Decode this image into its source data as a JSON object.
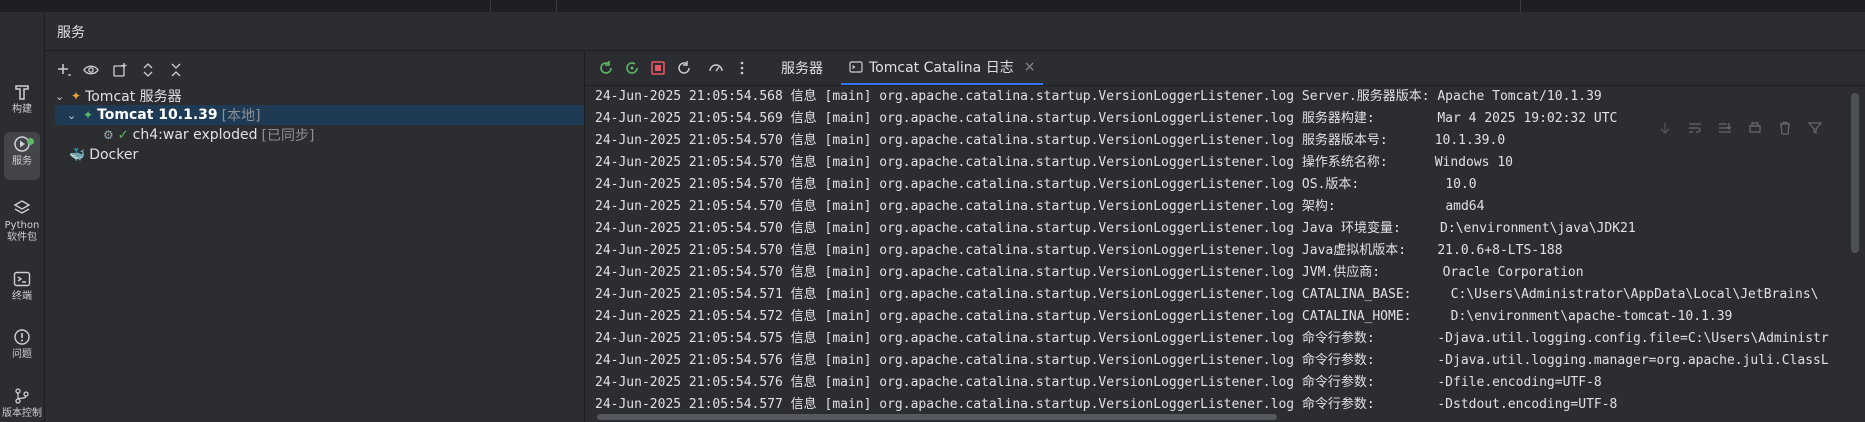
{
  "left_toolbar": [
    {
      "label": "构建",
      "icon": "hammer-icon"
    },
    {
      "label": "服务",
      "icon": "services-icon"
    },
    {
      "label": "Python\n软件包",
      "icon": "layers-icon"
    },
    {
      "label": "终端",
      "icon": "terminal-icon"
    },
    {
      "label": "问题",
      "icon": "problems-icon"
    },
    {
      "label": "版本控制",
      "icon": "git-branch-icon"
    }
  ],
  "panel": {
    "title": "服务"
  },
  "tree": {
    "root": {
      "label": "Tomcat 服务器"
    },
    "server": {
      "name": "Tomcat 10.1.39",
      "tag": "[本地]"
    },
    "artifact": {
      "name": "ch4:war exploded",
      "tag": "[已同步]"
    },
    "docker": {
      "label": "Docker"
    }
  },
  "log_tabs": [
    {
      "label": "服务器"
    },
    {
      "label": "Tomcat Catalina 日志",
      "close": "×"
    }
  ],
  "log_lines": [
    "24-Jun-2025 21:05:54.568 信息 [main] org.apache.catalina.startup.VersionLoggerListener.log Server.服务器版本: Apache Tomcat/10.1.39",
    "24-Jun-2025 21:05:54.569 信息 [main] org.apache.catalina.startup.VersionLoggerListener.log 服务器构建:        Mar 4 2025 19:02:32 UTC",
    "24-Jun-2025 21:05:54.570 信息 [main] org.apache.catalina.startup.VersionLoggerListener.log 服务器版本号:      10.1.39.0",
    "24-Jun-2025 21:05:54.570 信息 [main] org.apache.catalina.startup.VersionLoggerListener.log 操作系统名称:      Windows 10",
    "24-Jun-2025 21:05:54.570 信息 [main] org.apache.catalina.startup.VersionLoggerListener.log OS.版本:           10.0",
    "24-Jun-2025 21:05:54.570 信息 [main] org.apache.catalina.startup.VersionLoggerListener.log 架构:              amd64",
    "24-Jun-2025 21:05:54.570 信息 [main] org.apache.catalina.startup.VersionLoggerListener.log Java 环境变量:     D:\\environment\\java\\JDK21",
    "24-Jun-2025 21:05:54.570 信息 [main] org.apache.catalina.startup.VersionLoggerListener.log Java虚拟机版本:    21.0.6+8-LTS-188",
    "24-Jun-2025 21:05:54.570 信息 [main] org.apache.catalina.startup.VersionLoggerListener.log JVM.供应商:        Oracle Corporation",
    "24-Jun-2025 21:05:54.571 信息 [main] org.apache.catalina.startup.VersionLoggerListener.log CATALINA_BASE:     C:\\Users\\Administrator\\AppData\\Local\\JetBrains\\",
    "24-Jun-2025 21:05:54.572 信息 [main] org.apache.catalina.startup.VersionLoggerListener.log CATALINA_HOME:     D:\\environment\\apache-tomcat-10.1.39",
    "24-Jun-2025 21:05:54.575 信息 [main] org.apache.catalina.startup.VersionLoggerListener.log 命令行参数:        -Djava.util.logging.config.file=C:\\Users\\Administr",
    "24-Jun-2025 21:05:54.576 信息 [main] org.apache.catalina.startup.VersionLoggerListener.log 命令行参数:        -Djava.util.logging.manager=org.apache.juli.ClassL",
    "24-Jun-2025 21:05:54.576 信息 [main] org.apache.catalina.startup.VersionLoggerListener.log 命令行参数:        -Dfile.encoding=UTF-8",
    "24-Jun-2025 21:05:54.577 信息 [main] org.apache.catalina.startup.VersionLoggerListener.log 命令行参数:        -Dstdout.encoding=UTF-8"
  ],
  "colors": {
    "accent": "#3574f0",
    "selection": "#1f3a55",
    "stop": "#e55765",
    "run": "#5fb865"
  }
}
